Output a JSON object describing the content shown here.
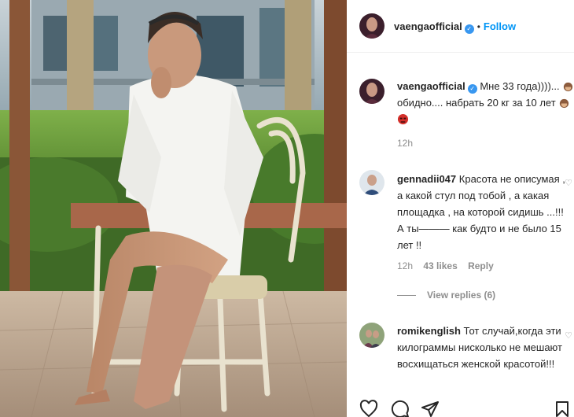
{
  "header": {
    "username": "vaengaofficial",
    "separator": "•",
    "follow_label": "Follow"
  },
  "caption": {
    "username": "vaengaofficial",
    "text_line1": "Мне 33 года))))...",
    "text_line2": "обидно.... набрать 20 кг за 10 лет",
    "time": "12h"
  },
  "comments": [
    {
      "username": "gennadii047",
      "text": "Красота не описумая , а какой стул под тобой , а какая площадка , на которой сидишь ...!!! А ты——— как будто и не было 15 лет !!",
      "time": "12h",
      "likes": "43 likes",
      "reply_label": "Reply",
      "view_replies": "View replies (6)"
    },
    {
      "username": "romikenglish",
      "text": "Тот случай,когда эти килограммы нисколько не мешают восхищаться женской красотой!!!"
    }
  ],
  "icons": [
    "verified-icon",
    "heart-icon",
    "comment-icon",
    "share-icon",
    "bookmark-icon"
  ],
  "colors": {
    "accent": "#0095f6",
    "verified": "#3897f0",
    "muted": "#8e8e8e"
  }
}
